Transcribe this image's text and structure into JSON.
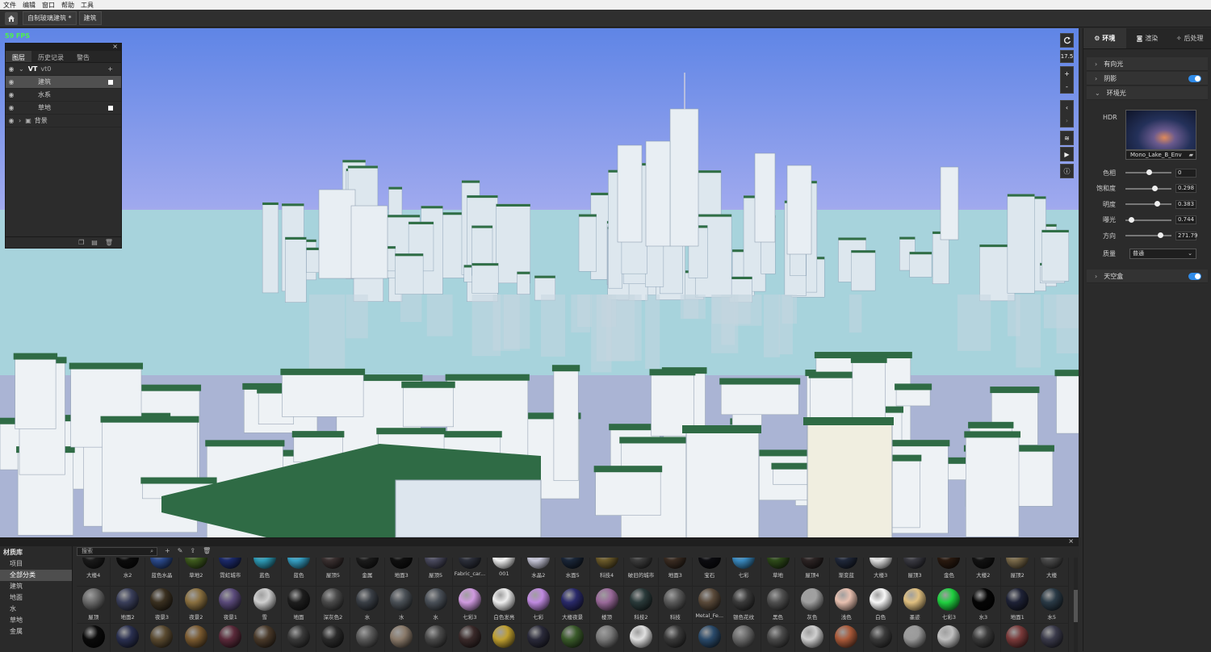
{
  "menu": [
    "文件",
    "编辑",
    "窗口",
    "帮助",
    "工具"
  ],
  "breadcrumbs": [
    "自制玻璃建筑 *",
    "建筑"
  ],
  "viewport": {
    "fps": "59 FPS",
    "fov": "17.5"
  },
  "layers": {
    "tabs": [
      "图层",
      "历史记录",
      "警告"
    ],
    "rows": [
      {
        "label": "VT",
        "sub": "vt0",
        "kind": "group"
      },
      {
        "label": "建筑",
        "kind": "item",
        "selected": true,
        "checked": true
      },
      {
        "label": "水系",
        "kind": "item"
      },
      {
        "label": "草地",
        "kind": "item",
        "checked": true
      },
      {
        "label": "背景",
        "kind": "folder"
      }
    ]
  },
  "right_panel": {
    "tabs": [
      "环境",
      "渲染",
      "后处理"
    ],
    "sections": {
      "directional": "有向光",
      "shadow": "阴影",
      "ambient": "环境光",
      "skybox": "天空盒"
    },
    "hdr_label": "HDR",
    "hdr_name": "Mono_Lake_B_Env",
    "sliders": [
      {
        "label": "色相",
        "value": "0",
        "pos": 0.5
      },
      {
        "label": "饱和度",
        "value": "0.298",
        "pos": 0.64
      },
      {
        "label": "明度",
        "value": "0.383",
        "pos": 0.69
      },
      {
        "label": "曝光",
        "value": "0.744",
        "pos": 0.12
      },
      {
        "label": "方向",
        "value": "271.79",
        "pos": 0.75
      }
    ],
    "quality_label": "质量",
    "quality_value": "普通"
  },
  "material_library": {
    "title": "材质库",
    "categories": [
      "项目",
      "全部分类",
      "建筑",
      "地面",
      "水",
      "草地",
      "金属"
    ],
    "search_placeholder": "搜索",
    "row1": [
      {
        "name": "大楼4",
        "color": "#1a1a1a"
      },
      {
        "name": "水2",
        "color": "#0c0c0c"
      },
      {
        "name": "蓝色水晶",
        "color": "#2b4a8c"
      },
      {
        "name": "草地2",
        "color": "#3e5a1e"
      },
      {
        "name": "霓虹城市",
        "color": "#1c2a6a"
      },
      {
        "name": "蓝色",
        "color": "#2e9bb6"
      },
      {
        "name": "蓝色",
        "color": "#36a0c4"
      },
      {
        "name": "屋顶5",
        "color": "#3a3030"
      },
      {
        "name": "金属",
        "color": "#1c1c1c"
      },
      {
        "name": "地面3",
        "color": "#101010"
      },
      {
        "name": "屋顶5",
        "color": "#4a4a5e"
      },
      {
        "name": "Fabric_car...",
        "color": "#2c2f3a"
      },
      {
        "name": "001",
        "color": "#f2f2f2"
      },
      {
        "name": "水晶2",
        "color": "#c6c6d8"
      },
      {
        "name": "水面5",
        "color": "#1a2638"
      },
      {
        "name": "科技4",
        "color": "#6b5a2a"
      },
      {
        "name": "破旧的城市",
        "color": "#3c3c3c"
      },
      {
        "name": "地面3",
        "color": "#3a2c22"
      },
      {
        "name": "宝石",
        "color": "#0c0c10"
      },
      {
        "name": "七彩",
        "color": "#3a8ac0"
      },
      {
        "name": "草地",
        "color": "#2e4a1a"
      },
      {
        "name": "屋顶4",
        "color": "#2c2424"
      },
      {
        "name": "渐变蓝",
        "color": "#20283a"
      },
      {
        "name": "大楼3",
        "color": "#e4e4e4"
      },
      {
        "name": "屋顶3",
        "color": "#3a3a42"
      },
      {
        "name": "金色",
        "color": "#2a1a10"
      },
      {
        "name": "大楼2",
        "color": "#121212"
      },
      {
        "name": "屋顶2",
        "color": "#7a6a4a"
      },
      {
        "name": "大楼",
        "color": "#4a4a4a"
      }
    ],
    "row2": [
      {
        "name": "屋顶",
        "color": "#6a6a6a"
      },
      {
        "name": "地面2",
        "color": "#3a3f5a"
      },
      {
        "name": "夜景3",
        "color": "#3a3020"
      },
      {
        "name": "夜景2",
        "color": "#8a7040"
      },
      {
        "name": "夜景1",
        "color": "#5a4a7a"
      },
      {
        "name": "雪",
        "color": "#cfcfcf"
      },
      {
        "name": "地面",
        "color": "#1e1e1e"
      },
      {
        "name": "深灰色2",
        "color": "#4a4a4a"
      },
      {
        "name": "水",
        "color": "#3a3f46"
      },
      {
        "name": "水",
        "color": "#4a5056"
      },
      {
        "name": "水",
        "color": "#4a5058"
      },
      {
        "name": "七彩3",
        "color": "#d09ae0"
      },
      {
        "name": "白色发亮",
        "color": "#eeeeee"
      },
      {
        "name": "七彩",
        "color": "#c08ae0"
      },
      {
        "name": "大楼夜景",
        "color": "#2a2a6a"
      },
      {
        "name": "楼顶",
        "color": "#9a6a9a"
      },
      {
        "name": "科技2",
        "color": "#2a3a3a"
      },
      {
        "name": "科技",
        "color": "#5a5a5a"
      },
      {
        "name": "Metal_Fe...",
        "color": "#5a4a3a"
      },
      {
        "name": "银色花纹",
        "color": "#3a3a3a"
      },
      {
        "name": "黑色",
        "color": "#505050"
      },
      {
        "name": "灰色",
        "color": "#a0a0a0"
      },
      {
        "name": "浅色",
        "color": "#e8c0b0"
      },
      {
        "name": "白色",
        "color": "#f8f8f8"
      },
      {
        "name": "墨迹",
        "color": "#e0c080"
      },
      {
        "name": "七彩3",
        "color": "#20d040"
      },
      {
        "name": "水3",
        "color": "#050505"
      },
      {
        "name": "地面1",
        "color": "#1e2236"
      },
      {
        "name": "水5",
        "color": "#2a3a46"
      }
    ],
    "row3": [
      {
        "color": "#0a0a0a"
      },
      {
        "color": "#2a3050"
      },
      {
        "color": "#5a4a30"
      },
      {
        "color": "#7a5a30"
      },
      {
        "color": "#5a2a3a"
      },
      {
        "color": "#4a3a2a"
      },
      {
        "color": "#3a3a3a"
      },
      {
        "color": "#2a2a2a"
      },
      {
        "color": "#5a5a5a"
      },
      {
        "color": "#8a7a6a"
      },
      {
        "color": "#4a4a4a"
      },
      {
        "color": "#3a2a2a"
      },
      {
        "color": "#c0a030"
      },
      {
        "color": "#2a2a3a"
      },
      {
        "color": "#3a5a2a"
      },
      {
        "color": "#7a7a7a"
      },
      {
        "color": "#e0e0e0"
      },
      {
        "color": "#3a3a3a"
      },
      {
        "color": "#2a4a6a"
      },
      {
        "color": "#6a6a6a"
      },
      {
        "color": "#4a4a4a"
      },
      {
        "color": "#d0d0d0"
      },
      {
        "color": "#aa5a3a"
      },
      {
        "color": "#3a3a3a"
      },
      {
        "color": "#9a9a9a"
      },
      {
        "color": "#c0c0c0"
      },
      {
        "color": "#3a3a3a"
      },
      {
        "color": "#7a3a3a"
      },
      {
        "color": "#3a3a4a"
      }
    ]
  }
}
